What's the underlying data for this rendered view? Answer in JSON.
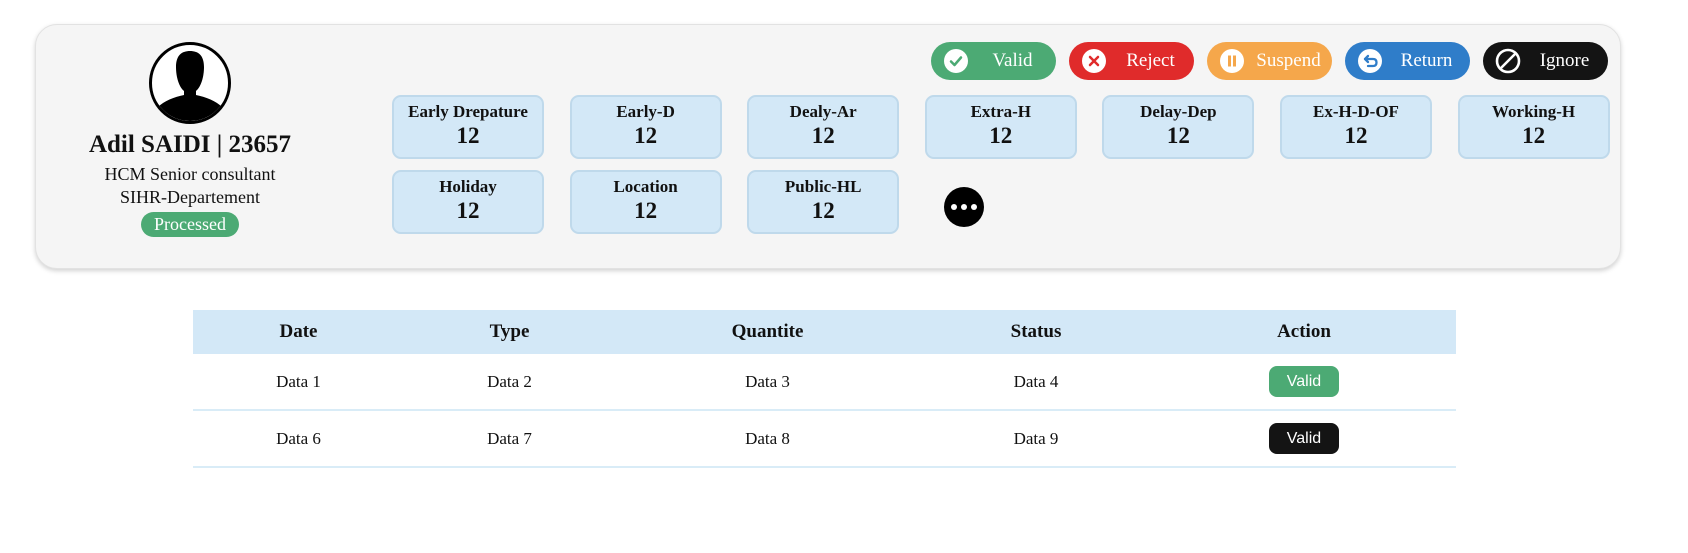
{
  "profile": {
    "name": "Adil SAIDI | 23657",
    "role": "HCM Senior consultant",
    "department": "SIHR-Departement",
    "status": "Processed",
    "status_color": "#4caa74",
    "avatar_icon": "person-silhouette-icon"
  },
  "actions": [
    {
      "label": "Valid",
      "color": "#4caa74",
      "icon": "check-circle-icon"
    },
    {
      "label": "Reject",
      "color": "#e02b2b",
      "icon": "x-circle-icon"
    },
    {
      "label": "Suspend",
      "color": "#f5a74b",
      "icon": "pause-circle-icon"
    },
    {
      "label": "Return",
      "color": "#2f7dc9",
      "icon": "return-arrow-icon"
    },
    {
      "label": "Ignore",
      "color": "#141414",
      "icon": "ban-icon"
    }
  ],
  "stats": [
    {
      "label": "Early Drepature",
      "value": "12"
    },
    {
      "label": "Early-D",
      "value": "12"
    },
    {
      "label": "Dealy-Ar",
      "value": "12"
    },
    {
      "label": "Extra-H",
      "value": "12"
    },
    {
      "label": "Delay-Dep",
      "value": "12"
    },
    {
      "label": "Ex-H-D-OF",
      "value": "12"
    },
    {
      "label": "Working-H",
      "value": "12"
    },
    {
      "label": "Holiday",
      "value": "12"
    },
    {
      "label": "Location",
      "value": "12"
    },
    {
      "label": "Public-HL",
      "value": "12"
    }
  ],
  "more_icon": "more-dots-icon",
  "table": {
    "headers": [
      "Date",
      "Type",
      "Quantite",
      "Status",
      "Action"
    ],
    "rows": [
      {
        "cells": [
          "Data 1",
          "Data 2",
          "Data 3",
          "Data 4"
        ],
        "action": "Valid",
        "action_color": "#4caa74"
      },
      {
        "cells": [
          "Data 6",
          "Data 7",
          "Data 8",
          "Data 9"
        ],
        "action": "Valid",
        "action_color": "#141414"
      }
    ]
  }
}
